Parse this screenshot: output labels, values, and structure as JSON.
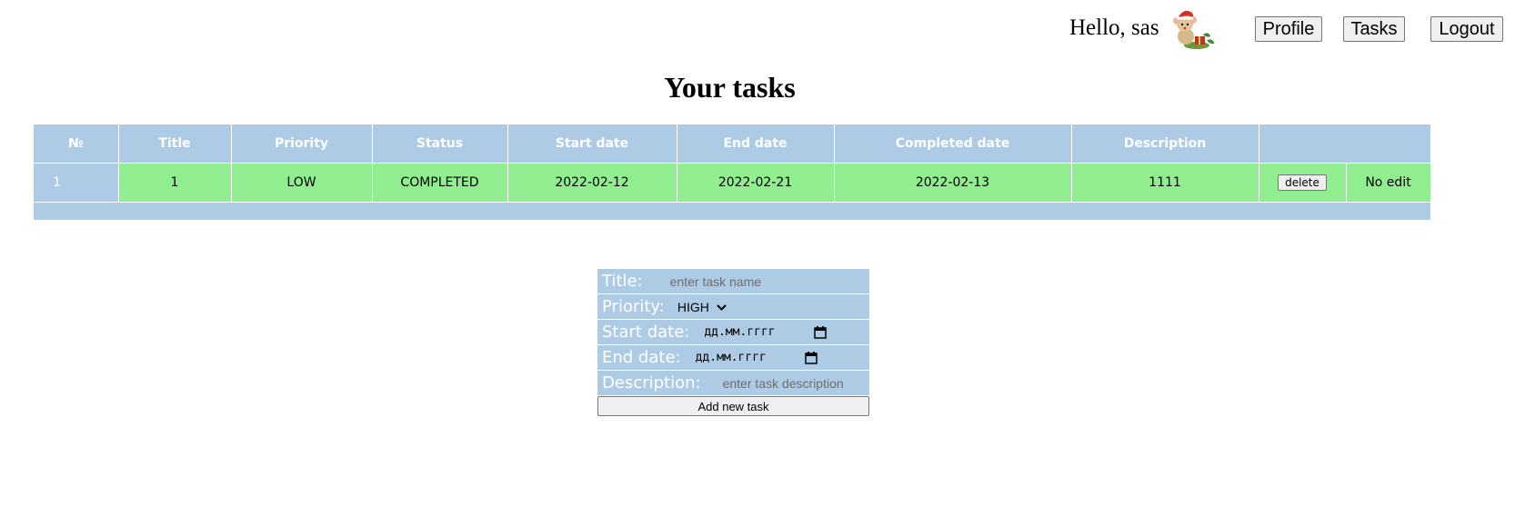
{
  "header": {
    "greeting": "Hello, sas",
    "avatar_icon": "santa-mouse-icon",
    "buttons": {
      "profile": "Profile",
      "tasks": "Tasks",
      "logout": "Logout"
    }
  },
  "page_title": "Your tasks",
  "table": {
    "headers": [
      "№",
      "Title",
      "Priority",
      "Status",
      "Start date",
      "End date",
      "Completed date",
      "Description",
      ""
    ],
    "rows": [
      {
        "num": "1",
        "title": "1",
        "priority": "LOW",
        "status": "COMPLETED",
        "start_date": "2022-02-12",
        "end_date": "2022-02-21",
        "completed_date": "2022-02-13",
        "description": "1111",
        "delete_label": "delete",
        "edit_label": "No edit"
      }
    ]
  },
  "form": {
    "title_label": "Title:",
    "title_placeholder": "enter task name",
    "priority_label": "Priority:",
    "priority_value": "HIGH",
    "start_label": "Start date:",
    "start_placeholder": "дд.мм.гггг",
    "end_label": "End date:",
    "end_placeholder": "дд.мм.гггг",
    "description_label": "Description:",
    "description_placeholder": "enter task description",
    "submit_label": "Add new task"
  },
  "colors": {
    "table_header": "#aecbe6",
    "completed_row": "#90ee90",
    "form_background": "#aecbe6"
  }
}
